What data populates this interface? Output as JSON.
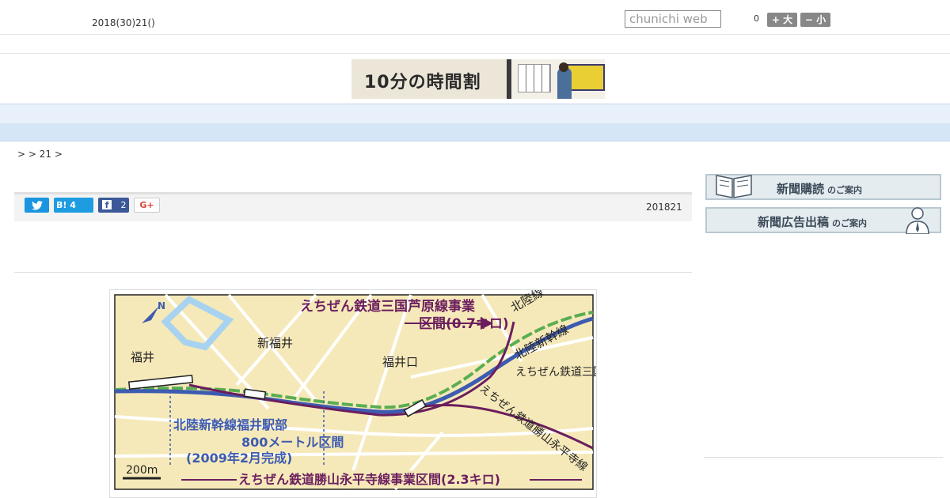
{
  "header": {
    "date": "2018(30)21()",
    "search_placeholder": "chunichi web",
    "count": "0",
    "font_large_label": "+ 大",
    "font_small_label": "− 小"
  },
  "banner": {
    "title": "10分の時間割"
  },
  "nav": {
    "items": [
      "",
      "",
      "",
      "",
      "",
      "",
      "",
      "",
      ""
    ]
  },
  "breadcrumb": {
    "text": ">  > 21 >"
  },
  "share": {
    "hatena_label": "B! 4",
    "facebook_count": "2",
    "gplus_label": "G+"
  },
  "article": {
    "published": "201821"
  },
  "map": {
    "labels": {
      "fukui": "福井",
      "shinfukui": "新福井",
      "fukuiguchi": "福井口",
      "hokuriku_line": "北陸線",
      "hokuriku_shinkansen": "北陸新幹線",
      "mikuni_line": "えちぜん鉄道三国芦原線",
      "katsuyama_line": "えちぜん鉄道勝山永平寺線",
      "mikuni_project": "えちぜん鉄道三国芦原線事業",
      "mikuni_section": "区間(0.7キロ)",
      "station_section": "北陸新幹線福井駅部",
      "station_length": "800メートル区間",
      "station_completed": "(2009年2月完成)",
      "katsuyama_project": "えちぜん鉄道勝山永平寺線事業区間(2.3キロ)",
      "scale": "200m",
      "north": "N"
    }
  },
  "sidebar": {
    "subscribe_main": "新聞購読",
    "subscribe_sub": "のご案内",
    "ad_main": "新聞広告出稿",
    "ad_sub": "のご案内"
  },
  "colors": {
    "nav_bg": "#e8f1fb",
    "map_bg": "#f6e9b9",
    "echizen_purple": "#6b1e5e",
    "shinkansen_blue": "#3d5bb0",
    "hokuriku_green": "#5aae52"
  }
}
